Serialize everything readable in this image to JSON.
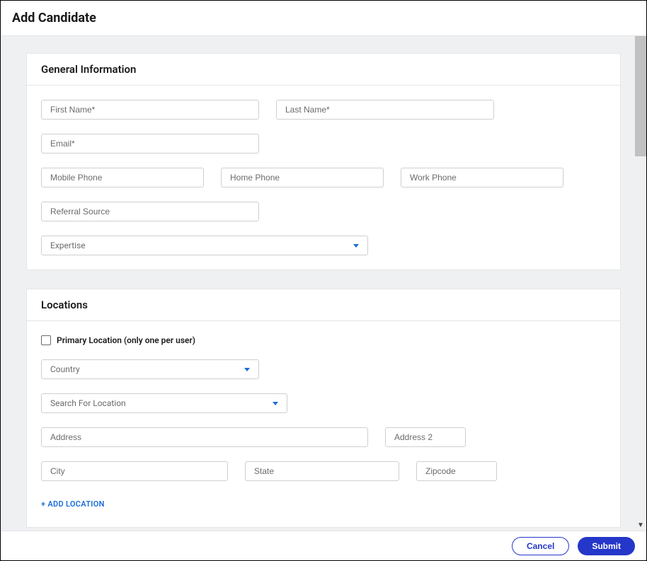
{
  "header": {
    "title": "Add Candidate"
  },
  "sections": {
    "general": {
      "title": "General Information",
      "fields": {
        "first_name": {
          "placeholder": "First Name*",
          "value": ""
        },
        "last_name": {
          "placeholder": "Last Name*",
          "value": ""
        },
        "email": {
          "placeholder": "Email*",
          "value": ""
        },
        "mobile_phone": {
          "placeholder": "Mobile Phone",
          "value": ""
        },
        "home_phone": {
          "placeholder": "Home Phone",
          "value": ""
        },
        "work_phone": {
          "placeholder": "Work Phone",
          "value": ""
        },
        "referral_source": {
          "placeholder": "Referral Source",
          "value": ""
        },
        "expertise": {
          "label": "Expertise"
        }
      }
    },
    "locations": {
      "title": "Locations",
      "primary_checkbox_label": "Primary Location (only one per user)",
      "fields": {
        "country": {
          "label": "Country"
        },
        "search_location": {
          "label": "Search For Location"
        },
        "address": {
          "placeholder": "Address",
          "value": ""
        },
        "address2": {
          "placeholder": "Address 2",
          "value": ""
        },
        "city": {
          "placeholder": "City",
          "value": ""
        },
        "state": {
          "placeholder": "State",
          "value": ""
        },
        "zipcode": {
          "placeholder": "Zipcode",
          "value": ""
        }
      },
      "add_location_label": "+ ADD LOCATION"
    }
  },
  "footer": {
    "cancel": "Cancel",
    "submit": "Submit"
  }
}
